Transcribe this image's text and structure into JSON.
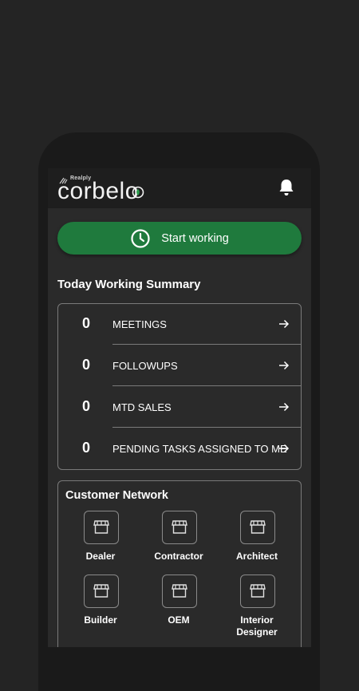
{
  "app": {
    "brand_small": "Realply",
    "brand_name": "corbelo",
    "notification_icon": "bell-icon"
  },
  "start_button": {
    "label": "Start working",
    "icon": "clock-icon",
    "color": "#1f7a3d"
  },
  "summary": {
    "title": "Today Working Summary",
    "items": [
      {
        "count": "0",
        "label": "MEETINGS"
      },
      {
        "count": "0",
        "label": "FOLLOWUPS"
      },
      {
        "count": "0",
        "label": "MTD SALES"
      },
      {
        "count": "0",
        "label": "PENDING TASKS ASSIGNED TO ME"
      }
    ]
  },
  "network": {
    "title": "Customer Network",
    "items": [
      {
        "label": "Dealer",
        "icon": "store-icon"
      },
      {
        "label": "Contractor",
        "icon": "store-icon"
      },
      {
        "label": "Architect",
        "icon": "store-icon"
      },
      {
        "label": "Builder",
        "icon": "store-icon"
      },
      {
        "label": "OEM",
        "icon": "store-icon"
      },
      {
        "label": "Interior Designer",
        "icon": "store-icon"
      }
    ]
  }
}
